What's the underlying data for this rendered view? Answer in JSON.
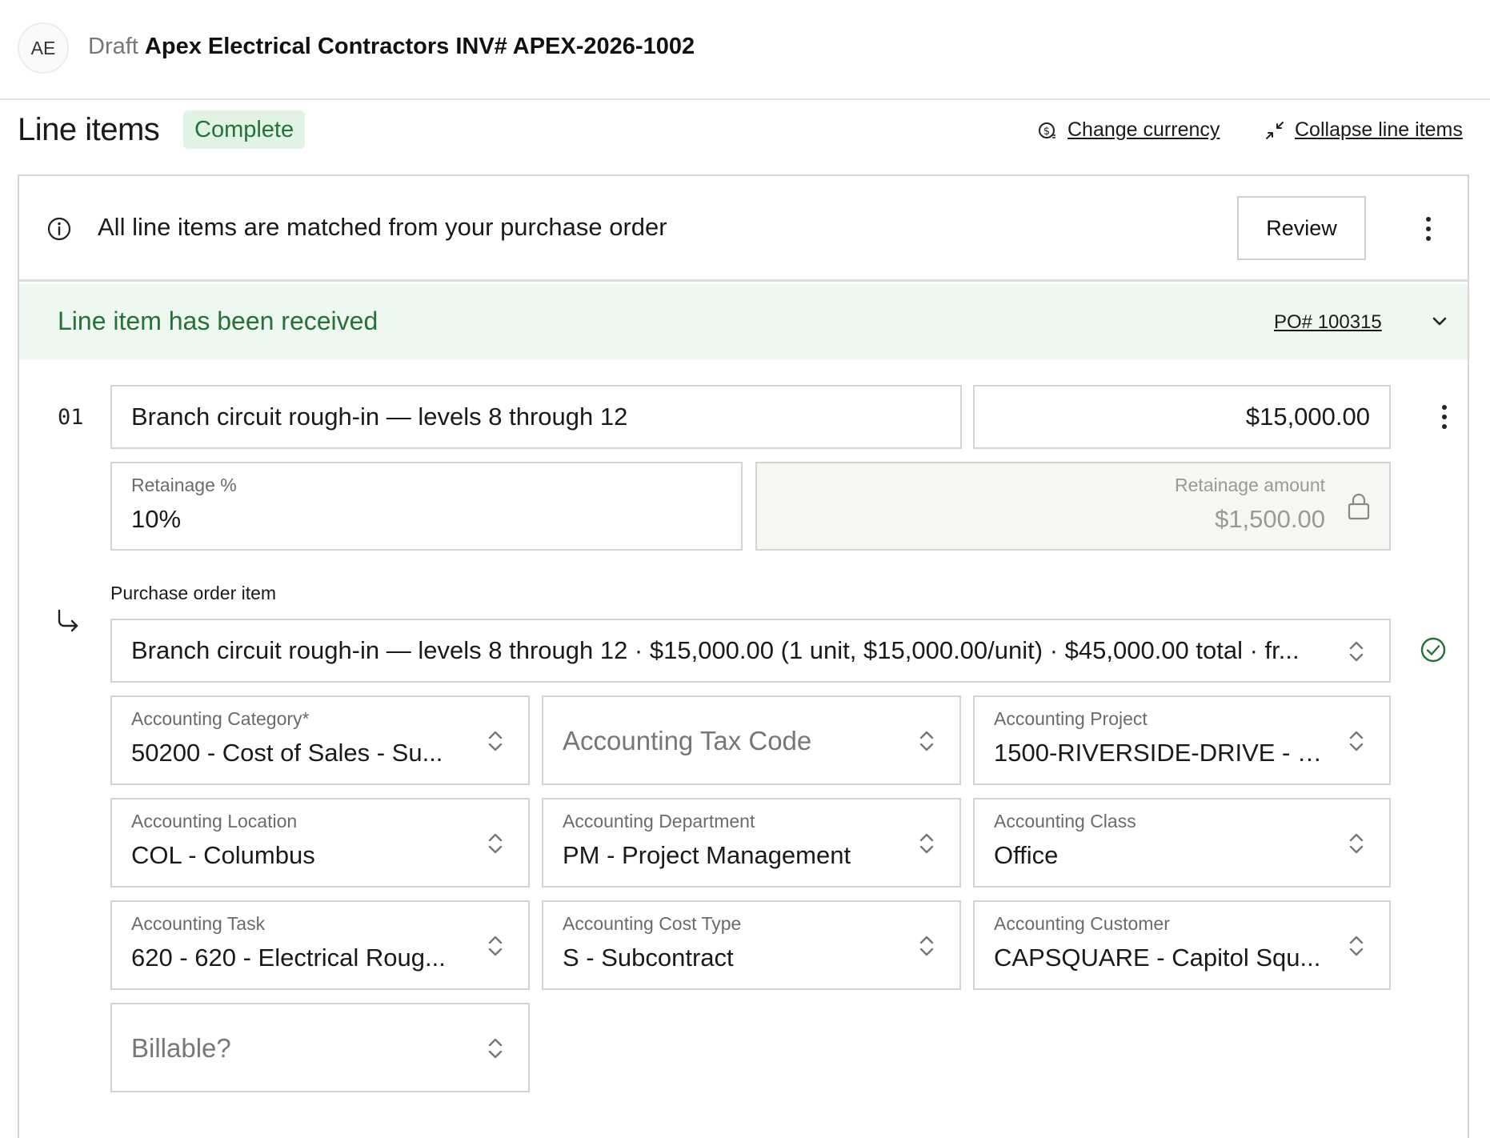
{
  "header": {
    "avatar_initials": "AE",
    "status": "Draft",
    "vendor_invoice": "Apex Electrical Contractors INV# APEX-2026-1002"
  },
  "section": {
    "title": "Line items",
    "status_badge": "Complete",
    "change_currency": "Change currency",
    "collapse": "Collapse line items"
  },
  "banner": {
    "message": "All line items are matched from your purchase order",
    "review_label": "Review"
  },
  "received": {
    "message": "Line item has been received",
    "po_link": "PO# 100315"
  },
  "line_item": {
    "number": "01",
    "description": "Branch circuit rough-in — levels 8 through 12",
    "amount": "$15,000.00",
    "retainage_pct_label": "Retainage %",
    "retainage_pct": "10%",
    "retainage_amount_label": "Retainage amount",
    "retainage_amount": "$1,500.00",
    "po_item_label": "Purchase order item",
    "po_item_value": "Branch circuit rough-in — levels 8 through 12 · $15,000.00 (1 unit, $15,000.00/unit) · $45,000.00 total · fr..."
  },
  "fields": {
    "category": {
      "label": "Accounting Category*",
      "value": "50200 - Cost of Sales - Su..."
    },
    "tax_code": {
      "placeholder": "Accounting Tax Code"
    },
    "project": {
      "label": "Accounting Project",
      "value": "1500-RIVERSIDE-DRIVE - 1..."
    },
    "location": {
      "label": "Accounting Location",
      "value": "COL - Columbus"
    },
    "department": {
      "label": "Accounting Department",
      "value": "PM - Project Management"
    },
    "class": {
      "label": "Accounting Class",
      "value": "Office"
    },
    "task": {
      "label": "Accounting Task",
      "value": "620 - 620 - Electrical Roug..."
    },
    "cost_type": {
      "label": "Accounting Cost Type",
      "value": "S - Subcontract"
    },
    "customer": {
      "label": "Accounting Customer",
      "value": "CAPSQUARE - Capitol Squ..."
    },
    "billable": {
      "placeholder": "Billable?"
    }
  },
  "colors": {
    "success_text": "#24713a",
    "success_bg": "#eef8f0",
    "badge_bg": "#e1f3e5",
    "border": "#d4d4d4"
  },
  "icons": [
    "info-icon",
    "kebab-icon",
    "chevron-down-icon",
    "lock-icon",
    "currency-icon",
    "collapse-icon",
    "subitem-arrow-icon",
    "check-circle-icon",
    "updown-icon"
  ]
}
